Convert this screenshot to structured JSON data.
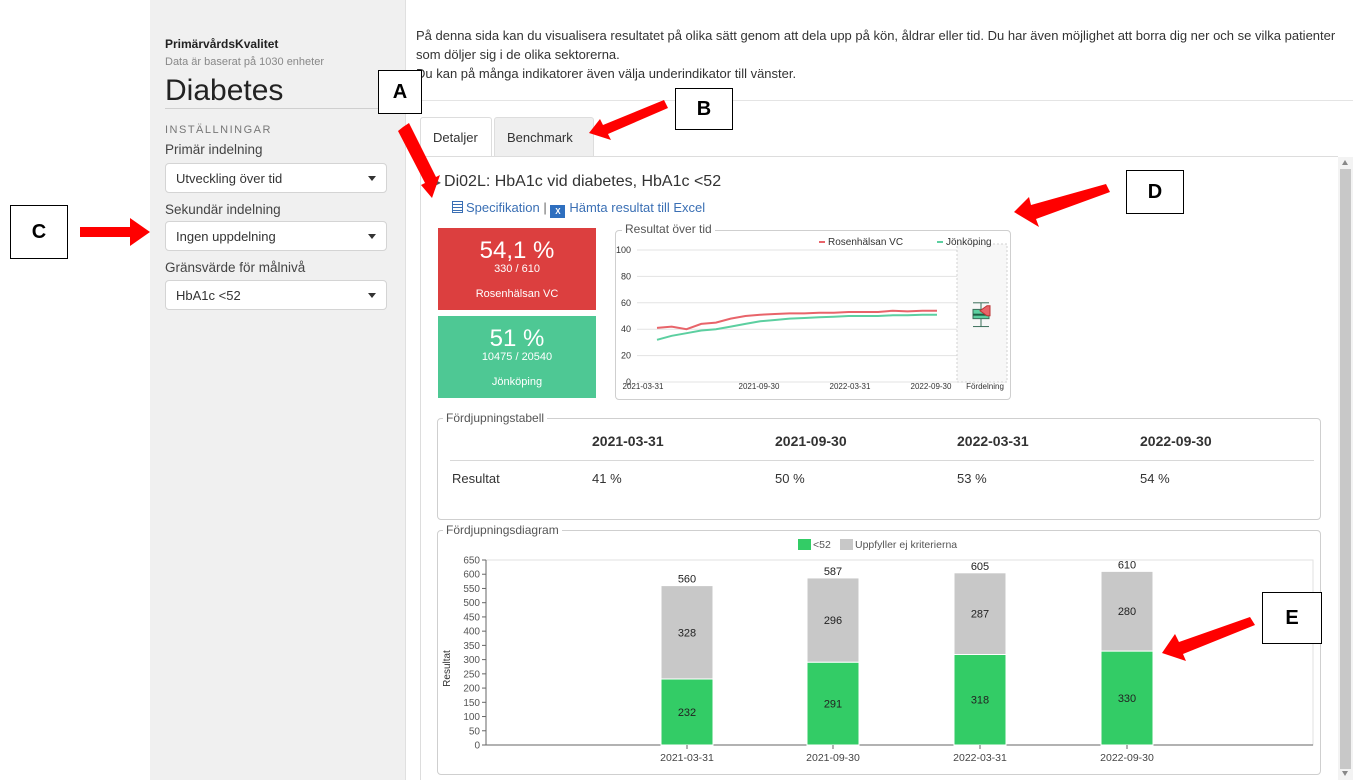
{
  "sidebar": {
    "app_name": "PrimärvårdsKvalitet",
    "subtitle": "Data är baserat på 1030 enheter",
    "page_title": "Diabetes",
    "settings_heading": "INSTÄLLNINGAR",
    "primary": {
      "label": "Primär indelning",
      "value": "Utveckling över tid"
    },
    "secondary": {
      "label": "Sekundär indelning",
      "value": "Ingen uppdelning"
    },
    "threshold": {
      "label": "Gränsvärde för målnivå",
      "value": "HbA1c <52"
    }
  },
  "intro": {
    "line1": "På denna sida kan du visualisera resultatet på olika sätt genom att dela upp på kön, åldrar eller tid. Du har även möjlighet att borra dig ner och se vilka patienter som döljer sig i de olika sektorerna.",
    "line2": "Du kan på många indikatorer även välja underindikator till vänster."
  },
  "tabs": {
    "details": "Detaljer",
    "benchmark": "Benchmark"
  },
  "indicator": {
    "caret": "▸",
    "title": "Di02L: HbA1c vid diabetes, HbA1c <52",
    "spec_link": "Specifikation",
    "separator": "|",
    "excel_link": "Hämta resultat till Excel",
    "excel_icon": "X"
  },
  "kpis": {
    "unit": {
      "pct": "54,1 %",
      "frac": "330 / 610",
      "name": "Rosenhälsan VC",
      "color": "#dc3f3f"
    },
    "region": {
      "pct": "51 %",
      "frac": "10475 / 20540",
      "name": "Jönköping",
      "color": "#4ec894"
    }
  },
  "trend": {
    "legend_title": "Resultat över tid",
    "series_a_name": "Rosenhälsan VC",
    "series_b_name": "Jönköping",
    "color_a": "#e8646a",
    "color_b": "#5ccfa0",
    "yticks": [
      "100",
      "80",
      "60",
      "40",
      "20",
      "0"
    ],
    "xticks": [
      "2021-03-31",
      "2021-09-30",
      "2022-03-31",
      "2022-09-30"
    ],
    "distribution_label": "Fördelning"
  },
  "table": {
    "legend_title": "Fördjupningstabell",
    "columns": [
      "2021-03-31",
      "2021-09-30",
      "2022-03-31",
      "2022-09-30"
    ],
    "row_label": "Resultat",
    "values": [
      "41 %",
      "50 %",
      "53 %",
      "54 %"
    ]
  },
  "barchart": {
    "legend_title": "Fördjupningsdiagram",
    "legend_met": "<52",
    "legend_not_met": "Uppfyller ej kriterierna",
    "ylabel": "Resultat",
    "yticks": [
      "650",
      "600",
      "550",
      "500",
      "450",
      "400",
      "350",
      "300",
      "250",
      "200",
      "150",
      "100",
      "50",
      "0"
    ]
  },
  "chart_data": [
    {
      "type": "line",
      "title": "Resultat över tid",
      "x_ticks": [
        "2021-03-31",
        "2021-09-30",
        "2022-03-31",
        "2022-09-30"
      ],
      "ylim": [
        0,
        100
      ],
      "grid": true,
      "legend": "top-right",
      "series": [
        {
          "name": "Rosenhälsan VC",
          "values": [
            41,
            42,
            40,
            44,
            45,
            48,
            50,
            51,
            51.5,
            52,
            52,
            52.5,
            52.5,
            53,
            53,
            53,
            54,
            53.5,
            54,
            54
          ]
        },
        {
          "name": "Jönköping",
          "values": [
            32,
            35,
            37,
            39,
            40,
            42,
            44,
            46,
            47,
            48,
            48.5,
            49,
            49.5,
            50,
            50,
            50,
            50.5,
            50.5,
            51,
            51
          ]
        }
      ]
    },
    {
      "type": "bar",
      "stacked": true,
      "title": "Fördjupningsdiagram",
      "ylabel": "Resultat",
      "categories": [
        "2021-03-31",
        "2021-09-30",
        "2022-03-31",
        "2022-09-30"
      ],
      "ylim": [
        0,
        650
      ],
      "legend": "top",
      "totals": [
        560,
        587,
        605,
        610
      ],
      "series": [
        {
          "name": "<52",
          "values": [
            232,
            291,
            318,
            330
          ],
          "color": "#33cc66"
        },
        {
          "name": "Uppfyller ej kriterierna",
          "values": [
            328,
            296,
            287,
            280
          ],
          "color": "#c8c8c8"
        }
      ]
    }
  ],
  "annotations": {
    "a": "A",
    "b": "B",
    "c": "C",
    "d": "D",
    "e": "E",
    "arrow_color": "#ff0000"
  }
}
